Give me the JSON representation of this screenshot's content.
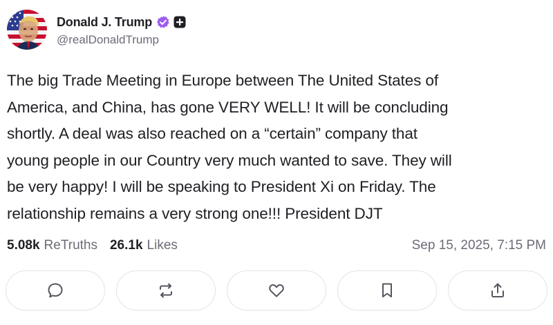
{
  "author": {
    "display_name": "Donald J. Trump",
    "handle": "@realDonaldTrump",
    "avatar_icon": "flag-portrait-avatar",
    "verified_icon": "verified-badge-icon",
    "plus_icon": "plus-badge-icon"
  },
  "post": {
    "text": "The big Trade Meeting in Europe between The United States of\nAmerica, and China,  has gone VERY WELL! It will be concluding\nshortly. A deal was also reached on a “certain” company that\nyoung people in our Country very much wanted to save. They will\nbe very happy! I will be speaking to President Xi on Friday. The\nrelationship remains a very strong one!!! President DJT"
  },
  "stats": {
    "retruths_count": "5.08k",
    "retruths_label": "ReTruths",
    "likes_count": "26.1k",
    "likes_label": "Likes",
    "timestamp": "Sep 15, 2025, 7:15 PM"
  },
  "actions": [
    {
      "name": "reply",
      "icon": "comment-icon"
    },
    {
      "name": "retruth",
      "icon": "repost-icon"
    },
    {
      "name": "like",
      "icon": "heart-icon"
    },
    {
      "name": "bookmark",
      "icon": "bookmark-icon"
    },
    {
      "name": "share",
      "icon": "share-icon"
    }
  ],
  "colors": {
    "text": "#1f1f24",
    "muted": "#6b6b78",
    "verified": "#9e5bf0",
    "border": "#e3e3ea"
  }
}
